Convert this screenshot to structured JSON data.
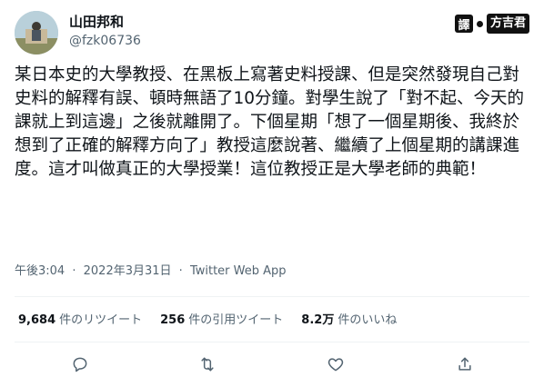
{
  "author": {
    "display_name": "山田邦和",
    "handle": "@fzk06736"
  },
  "watermark": {
    "icon_char": "譯",
    "text": "方吉君"
  },
  "tweet": {
    "text": "某日本史的大學教授、在黑板上寫著史料授課、但是突然發現自己對史料的解釋有誤、頓時無語了10分鐘。對學生說了「對不起、今天的課就上到這邊」之後就離開了。下個星期「想了一個星期後、我終於想到了正確的解釋方向了」教授這麼說著、繼續了上個星期的講課進度。這才叫做真正的大學授業！這位教授正是大學老師的典範！",
    "time": "午後3:04",
    "date": "2022年3月31日",
    "separator": "·",
    "source": "Twitter Web App"
  },
  "stats": {
    "retweets_count": "9,684",
    "retweets_label": "件のリツイート",
    "quotes_count": "256",
    "quotes_label": "件の引用ツイート",
    "likes_count": "8.2万",
    "likes_label": "件のいいね"
  },
  "icons": {
    "reply": "reply-icon",
    "retweet": "retweet-icon",
    "like": "heart-icon",
    "share": "share-icon"
  }
}
